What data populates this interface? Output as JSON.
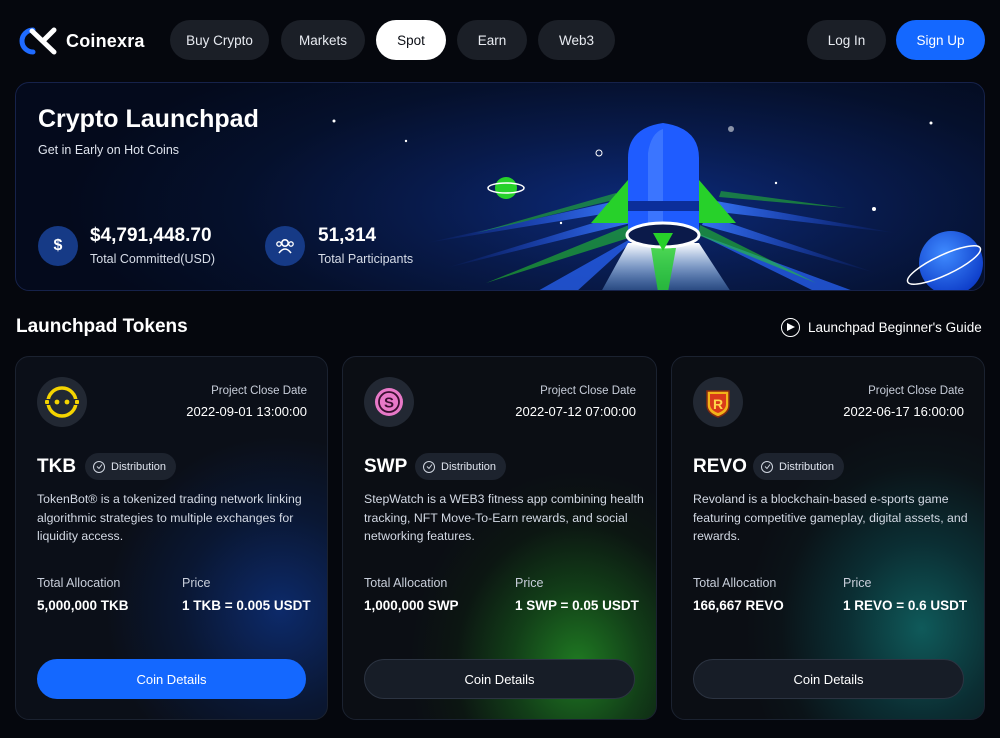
{
  "brand": {
    "name": "Coinexra"
  },
  "nav": {
    "items": [
      {
        "label": "Buy Crypto"
      },
      {
        "label": "Markets"
      },
      {
        "label": "Spot",
        "active": true
      },
      {
        "label": "Earn"
      },
      {
        "label": "Web3"
      }
    ],
    "login_label": "Log In",
    "signup_label": "Sign Up"
  },
  "hero": {
    "title": "Crypto Launchpad",
    "subtitle": "Get in Early on Hot Coins",
    "stats": [
      {
        "icon": "dollar-icon",
        "symbol": "$",
        "value": "$4,791,448.70",
        "label": "Total Committed(USD)"
      },
      {
        "icon": "users-icon",
        "value": "51,314",
        "label": "Total Participants"
      }
    ]
  },
  "section": {
    "title": "Launchpad Tokens",
    "guide_label": "Launchpad Beginner's Guide"
  },
  "tokens": [
    {
      "symbol": "TKB",
      "logo": "tokenbot-logo-icon",
      "close_label": "Project Close Date",
      "close_date": "2022-09-01 13:00:00",
      "status": "Distribution",
      "desc_lines": [
        "TokenBot® is a tokenized trading network linking",
        "algorithmic strategies to multiple exchanges for",
        "liquidity access."
      ],
      "alloc_label": "Total Allocation",
      "alloc_value": "5,000,000 TKB",
      "price_label": "Price",
      "price_value": "1 TKB = 0.005 USDT",
      "button_label": "Coin Details"
    },
    {
      "symbol": "SWP",
      "logo": "stepwatch-logo-icon",
      "close_label": "Project Close Date",
      "close_date": "2022-07-12 07:00:00",
      "status": "Distribution",
      "desc_lines": [
        "StepWatch is a WEB3 fitness app combining health",
        "tracking, NFT Move-To-Earn rewards, and social",
        "networking features."
      ],
      "alloc_label": "Total Allocation",
      "alloc_value": "1,000,000 SWP",
      "price_label": "Price",
      "price_value": "1 SWP = 0.05 USDT",
      "button_label": "Coin Details"
    },
    {
      "symbol": "REVO",
      "logo": "revoland-logo-icon",
      "close_label": "Project Close Date",
      "close_date": "2022-06-17 16:00:00",
      "status": "Distribution",
      "desc_lines": [
        "Revoland is a blockchain-based e-sports game",
        "featuring competitive gameplay, digital assets, and",
        "rewards."
      ],
      "alloc_label": "Total Allocation",
      "alloc_value": "166,667 REVO",
      "price_label": "Price",
      "price_value": "1 REVO = 0.6 USDT",
      "button_label": "Coin Details"
    }
  ],
  "colors": {
    "accent": "#1468ff",
    "background": "#05070d",
    "pill": "#1b1f27",
    "rocket_green": "#27d12a",
    "rocket_blue": "#1f5cff",
    "tkb_yellow": "#f5d400",
    "swp_pink": "#e879c8",
    "revo_gold": "#f2b419"
  }
}
